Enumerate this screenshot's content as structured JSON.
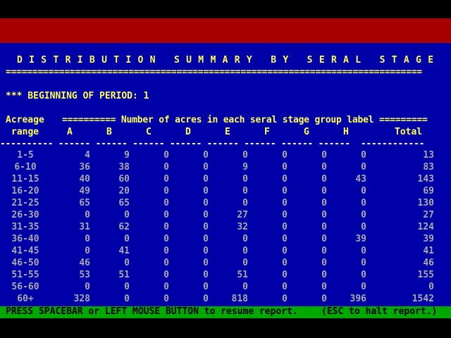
{
  "report": {
    "title": "D I S T R I B U T I O N   S U M M A R Y   B Y   S E R A L   S T A G E",
    "rule": "==============================================================================",
    "period_label": "*** BEGINNING OF PERIOD: 1",
    "header_line1_left": "Acreage",
    "header_line1_right": "========== Number of acres in each seral stage group label =========",
    "header_range": "range",
    "columns": [
      "A",
      "B",
      "C",
      "D",
      "E",
      "F",
      "G",
      "H"
    ],
    "total_label": "Total",
    "dash_line": "---------- ------ ------ ------ ------ ------ ------ ------ ------  ------------"
  },
  "rows": [
    {
      "range": "1-5",
      "values": [
        "4",
        "9",
        "0",
        "0",
        "0",
        "0",
        "0",
        "0"
      ],
      "total": "13"
    },
    {
      "range": "6-10",
      "values": [
        "36",
        "38",
        "0",
        "0",
        "9",
        "0",
        "0",
        "0"
      ],
      "total": "83"
    },
    {
      "range": "11-15",
      "values": [
        "40",
        "60",
        "0",
        "0",
        "0",
        "0",
        "0",
        "43"
      ],
      "total": "143"
    },
    {
      "range": "16-20",
      "values": [
        "49",
        "20",
        "0",
        "0",
        "0",
        "0",
        "0",
        "0"
      ],
      "total": "69"
    },
    {
      "range": "21-25",
      "values": [
        "65",
        "65",
        "0",
        "0",
        "0",
        "0",
        "0",
        "0"
      ],
      "total": "130"
    },
    {
      "range": "26-30",
      "values": [
        "0",
        "0",
        "0",
        "0",
        "27",
        "0",
        "0",
        "0"
      ],
      "total": "27"
    },
    {
      "range": "31-35",
      "values": [
        "31",
        "62",
        "0",
        "0",
        "32",
        "0",
        "0",
        "0"
      ],
      "total": "124"
    },
    {
      "range": "36-40",
      "values": [
        "0",
        "0",
        "0",
        "0",
        "0",
        "0",
        "0",
        "39"
      ],
      "total": "39"
    },
    {
      "range": "41-45",
      "values": [
        "0",
        "41",
        "0",
        "0",
        "0",
        "0",
        "0",
        "0"
      ],
      "total": "41"
    },
    {
      "range": "46-50",
      "values": [
        "46",
        "0",
        "0",
        "0",
        "0",
        "0",
        "0",
        "0"
      ],
      "total": "46"
    },
    {
      "range": "51-55",
      "values": [
        "53",
        "51",
        "0",
        "0",
        "51",
        "0",
        "0",
        "0"
      ],
      "total": "155"
    },
    {
      "range": "56-60",
      "values": [
        "0",
        "0",
        "0",
        "0",
        "0",
        "0",
        "0",
        "0"
      ],
      "total": "0"
    },
    {
      "range": "60+",
      "values": [
        "328",
        "0",
        "0",
        "0",
        "818",
        "0",
        "0",
        "396"
      ],
      "total": "1542"
    }
  ],
  "status": {
    "prompt": "PRESS SPACEBAR or LEFT MOUSE BUTTON to resume report.",
    "halt": "(ESC to halt report.)"
  },
  "colors": {
    "background": "#0000a8",
    "title_yellow": "#ffff55",
    "band_red": "#a80000",
    "status_green": "#00a800"
  }
}
